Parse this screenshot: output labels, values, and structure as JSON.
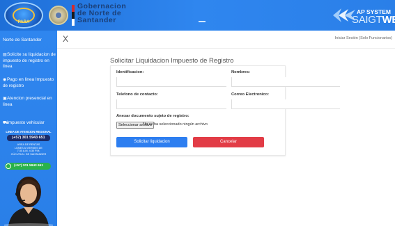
{
  "header": {
    "logo_text": "PARA",
    "gov_line1": "Gobernacion",
    "gov_line2": "de Norte de",
    "gov_line3": "Santander",
    "brand_line1": "AP SYSTEM",
    "brand_bold": "SAIGT",
    "brand_thin": "",
    "brand_end": "WEB",
    "colors": {
      "header_bg": "#2a7fe8",
      "gov_text": "#1b3f77"
    }
  },
  "sidebar": {
    "title": "Norte de Santander",
    "items": [
      {
        "icon": "document-icon",
        "label": "Solicite su liquidacion de impuesto de registro en linea"
      },
      {
        "icon": "globe-icon",
        "label": "Pago en linea Impuesto de registro"
      },
      {
        "icon": "monitor-icon",
        "label": "Atencion presencial en linea"
      },
      {
        "icon": "car-icon",
        "label": "Impuesto vehicular"
      }
    ],
    "contact": {
      "title": "LINEA DE ATENCION REGIONAL",
      "phone": "(+57) 301 5943 651",
      "hours_line1": "AREA DE RENTAS",
      "hours_line2": "LUNES A VIERNES DE",
      "hours_line3": "7:30 A.M. 4:30 P.M.",
      "hours_line4": "CÚCUTA N. DE SANTANDER"
    },
    "whatsapp": "(+57) 301 5943 651"
  },
  "topbar": {
    "close": "X",
    "user": "Iniciar Sesión (Solo Funcionarios)"
  },
  "form": {
    "title": "Solicitar Liquidacion Impuesto de Registro",
    "fields": {
      "identificacion": {
        "label": "Identificacion:",
        "value": ""
      },
      "nombres": {
        "label": "Nombres:",
        "value": ""
      },
      "telefono": {
        "label": "Telefono de contacto:",
        "value": ""
      },
      "correo": {
        "label": "Correo Electronico:",
        "value": ""
      }
    },
    "file": {
      "label": "Anexar documento sujeto de registro:",
      "button": "Seleccionar archivo",
      "status": "No se ha seleccionado ningún archivo"
    },
    "buttons": {
      "submit": "Solicitar liquidacion",
      "cancel": "Cancelar"
    },
    "colors": {
      "submit": "#2d7ef0",
      "cancel": "#e23c46"
    }
  }
}
